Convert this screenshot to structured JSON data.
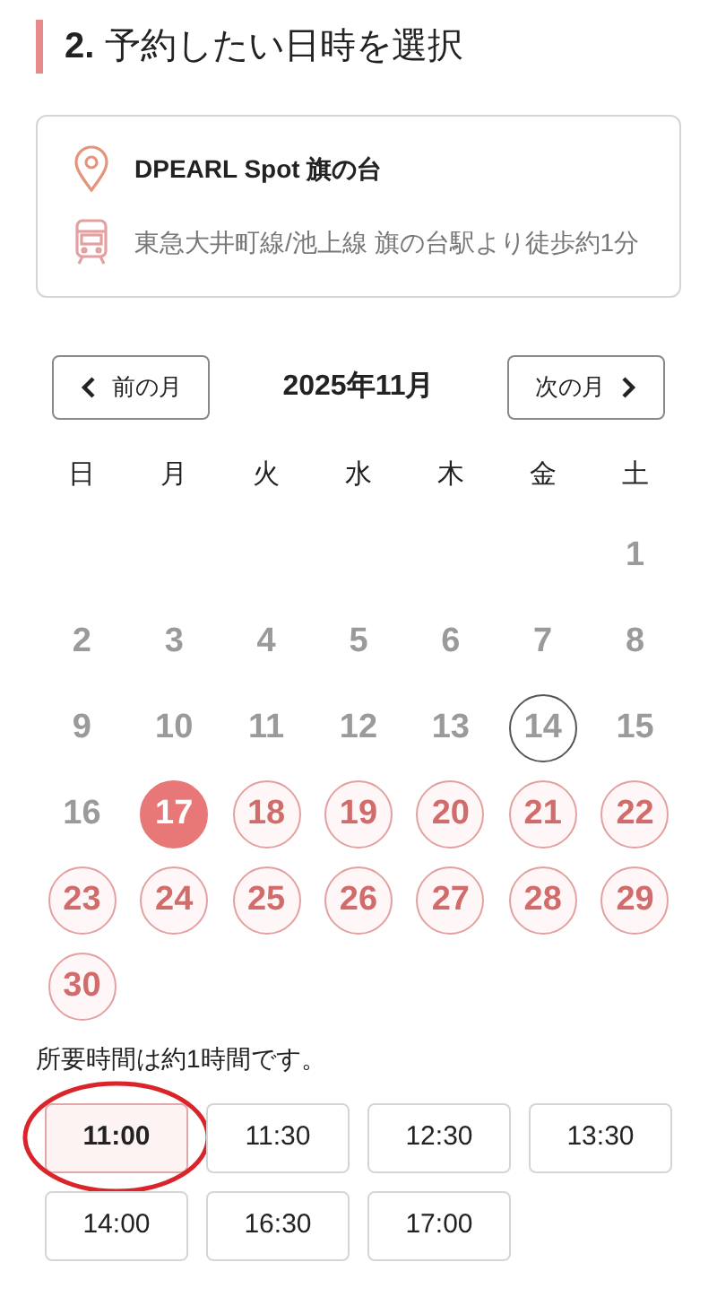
{
  "section_title": {
    "number": "2.",
    "text": "予約したい日時を選択"
  },
  "location": {
    "name": "DPEARL Spot 旗の台",
    "access": "東急大井町線/池上線 旗の台駅より徒歩約1分"
  },
  "calendar": {
    "prev_label": "前の月",
    "month": "2025年11月",
    "next_label": "次の月",
    "weekdays": [
      "日",
      "月",
      "火",
      "水",
      "木",
      "金",
      "土"
    ],
    "weeks": [
      [
        {
          "kind": "blank"
        },
        {
          "kind": "blank"
        },
        {
          "kind": "blank"
        },
        {
          "kind": "blank"
        },
        {
          "kind": "blank"
        },
        {
          "kind": "blank"
        },
        {
          "kind": "past",
          "day": "1"
        }
      ],
      [
        {
          "kind": "past",
          "day": "2"
        },
        {
          "kind": "past",
          "day": "3"
        },
        {
          "kind": "past",
          "day": "4"
        },
        {
          "kind": "past",
          "day": "5"
        },
        {
          "kind": "past",
          "day": "6"
        },
        {
          "kind": "past",
          "day": "7"
        },
        {
          "kind": "past",
          "day": "8"
        }
      ],
      [
        {
          "kind": "past",
          "day": "9"
        },
        {
          "kind": "past",
          "day": "10"
        },
        {
          "kind": "past",
          "day": "11"
        },
        {
          "kind": "past",
          "day": "12"
        },
        {
          "kind": "past",
          "day": "13"
        },
        {
          "kind": "today",
          "day": "14"
        },
        {
          "kind": "past",
          "day": "15"
        }
      ],
      [
        {
          "kind": "past",
          "day": "16"
        },
        {
          "kind": "available",
          "day": "17",
          "selected": true
        },
        {
          "kind": "available",
          "day": "18",
          "selected": false
        },
        {
          "kind": "available",
          "day": "19",
          "selected": false
        },
        {
          "kind": "available",
          "day": "20",
          "selected": false
        },
        {
          "kind": "available",
          "day": "21",
          "selected": false
        },
        {
          "kind": "available",
          "day": "22",
          "selected": false
        }
      ],
      [
        {
          "kind": "available",
          "day": "23",
          "selected": false
        },
        {
          "kind": "available",
          "day": "24",
          "selected": false
        },
        {
          "kind": "available",
          "day": "25",
          "selected": false
        },
        {
          "kind": "available",
          "day": "26",
          "selected": false
        },
        {
          "kind": "available",
          "day": "27",
          "selected": false
        },
        {
          "kind": "available",
          "day": "28",
          "selected": false
        },
        {
          "kind": "available",
          "day": "29",
          "selected": false
        }
      ],
      [
        {
          "kind": "available",
          "day": "30",
          "selected": false
        }
      ]
    ]
  },
  "duration_note": "所要時間は約1時間です。",
  "time_slots": [
    {
      "time": "11:00",
      "selected": true,
      "circled": true
    },
    {
      "time": "11:30",
      "selected": false,
      "circled": false
    },
    {
      "time": "12:30",
      "selected": false,
      "circled": false
    },
    {
      "time": "13:30",
      "selected": false,
      "circled": false
    },
    {
      "time": "14:00",
      "selected": false,
      "circled": false
    },
    {
      "time": "16:30",
      "selected": false,
      "circled": false
    },
    {
      "time": "17:00",
      "selected": false,
      "circled": false
    }
  ]
}
